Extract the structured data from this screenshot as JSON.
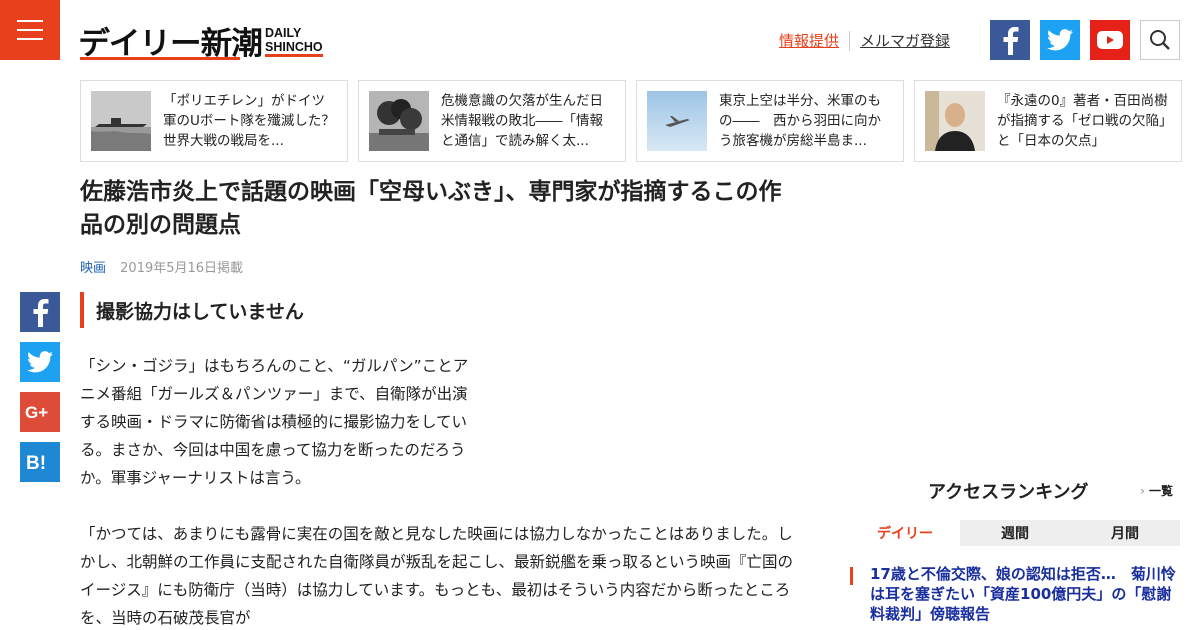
{
  "header": {
    "logo_jp": "デイリー新潮",
    "logo_en_line1": "DAILY",
    "logo_en_line2": "SHINCHO",
    "info_link": "情報提供",
    "mail_link": "メルマガ登録",
    "brand_color": "#e8401c"
  },
  "related": [
    {
      "title": "「ポリエチレン」がドイツ軍のUボート隊を殲滅した？ 世界大戦の戦局を...",
      "thumb": "submarine-photo"
    },
    {
      "title": "危機意識の欠落が生んだ日米情報戦の敗北――「情報と通信」で読み解く太...",
      "thumb": "explosion-photo"
    },
    {
      "title": "東京上空は半分、米軍のもの――　西から羽田に向かう旅客機が房総半島ま...",
      "thumb": "airplane-photo"
    },
    {
      "title": "『永遠の0』著者・百田尚樹が指摘する「ゼロ戦の欠陥」と「日本の欠点」",
      "thumb": "author-photo"
    }
  ],
  "article": {
    "title": "佐藤浩市炎上で話題の映画「空母いぶき」、専門家が指摘するこの作品の別の問題点",
    "category": "映画",
    "date": "2019年5月16日掲載",
    "subhead": "撮影協力はしていません",
    "para1": "「シン・ゴジラ」はもちろんのこと、“ガルパン”ことアニメ番組「ガールズ＆パンツァー」まで、自衛隊が出演する映画・ドラマに防衛省は積極的に撮影協力をしている。まさか、今回は中国を慮って協力を断ったのだろうか。軍事ジャーナリストは言う。",
    "para2": "「かつては、あまりにも露骨に実在の国を敵と見なした映画には協力しなかったことはありました。しかし、北朝鮮の工作員に支配された自衛隊員が叛乱を起こし、最新鋭艦を乗っ取るという映画『亡国のイージス』にも防衛庁（当時）は協力しています。もっとも、最初はそういう内容だから断ったところを、当時の石破茂長官が"
  },
  "ranking": {
    "title": "アクセスランキング",
    "all_link": "一覧",
    "tabs": [
      "デイリー",
      "週間",
      "月間"
    ],
    "active_tab": 0,
    "top_item": "17歳と不倫交際、娘の認知は拒否…　菊川怜は耳を塞ぎたい「資産100億円夫」の「慰謝料裁判」傍聴報告"
  },
  "icons": {
    "menu": "hamburger-icon",
    "facebook": "facebook-icon",
    "twitter": "twitter-icon",
    "youtube": "youtube-icon",
    "search": "search-icon",
    "googleplus": "googleplus-icon",
    "hatena": "hatena-bookmark-icon"
  }
}
